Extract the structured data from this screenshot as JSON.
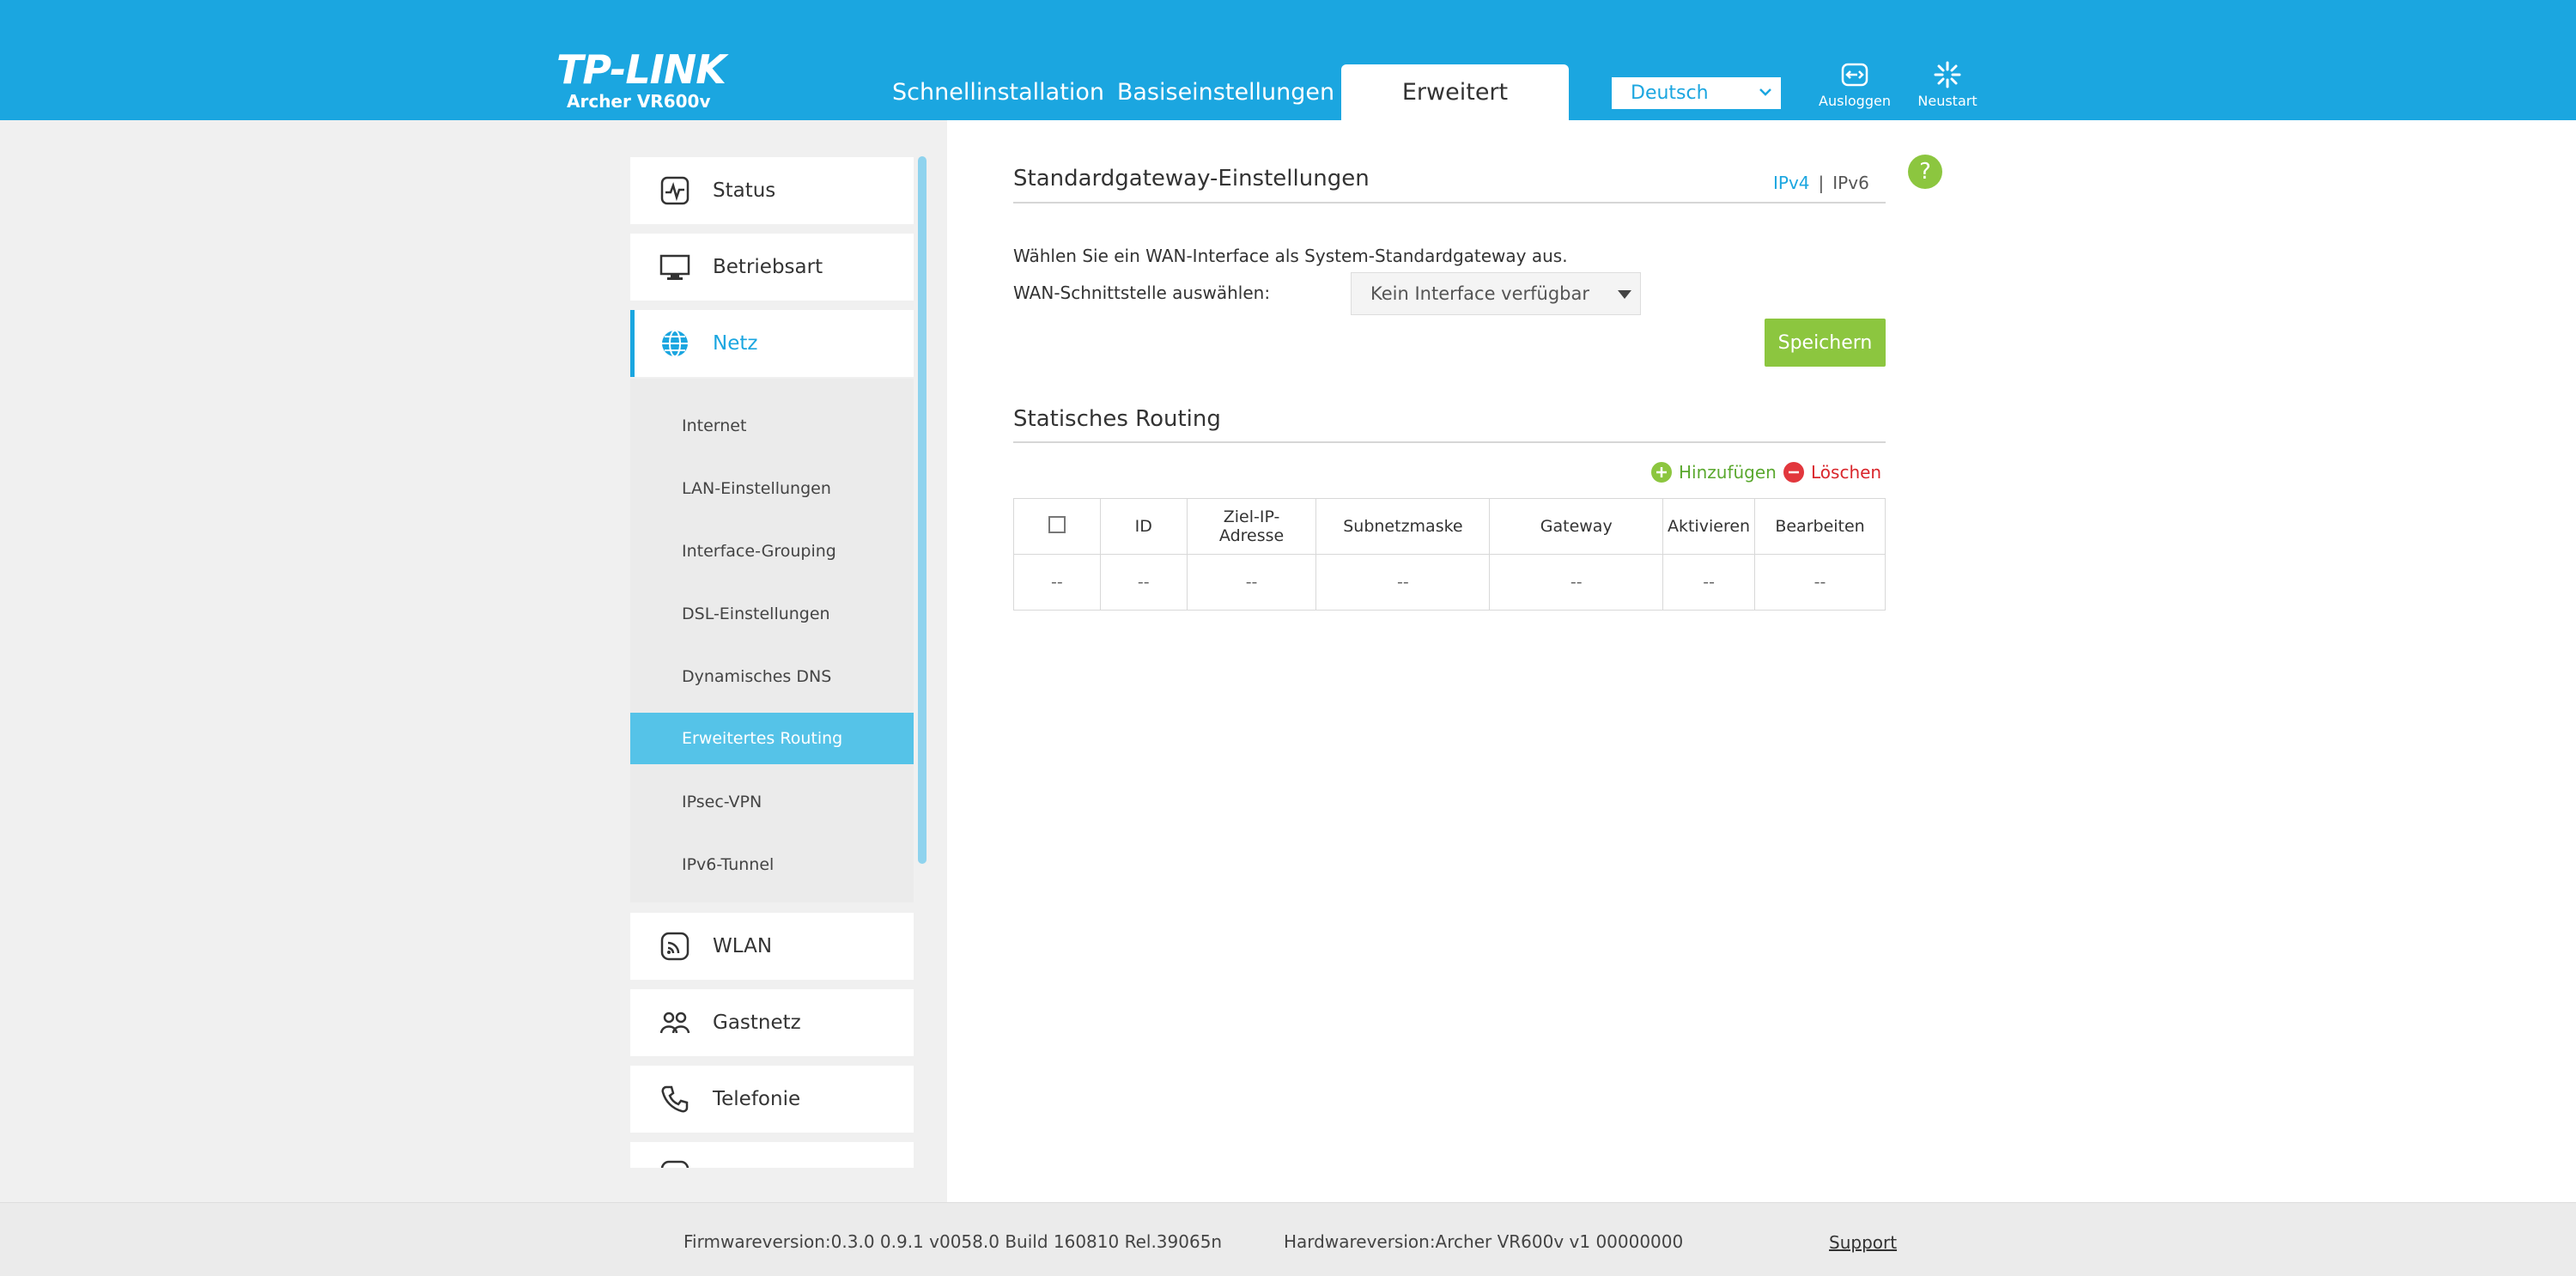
{
  "header": {
    "logo": "TP-LINK",
    "model": "Archer VR600v",
    "tabs": [
      {
        "label": "Schnellinstallation"
      },
      {
        "label": "Basiseinstellungen"
      },
      {
        "label": "Erweitert"
      }
    ],
    "language": "Deutsch",
    "logout_label": "Ausloggen",
    "restart_label": "Neustart",
    "brand_color": "#1ba6e0"
  },
  "sidebar": {
    "items": [
      {
        "label": "Status",
        "icon": "status-icon"
      },
      {
        "label": "Betriebsart",
        "icon": "monitor-icon"
      },
      {
        "label": "Netz",
        "icon": "globe-icon"
      },
      {
        "label": "WLAN",
        "icon": "wireless-icon"
      },
      {
        "label": "Gastnetz",
        "icon": "guests-icon"
      },
      {
        "label": "Telefonie",
        "icon": "phone-icon"
      }
    ],
    "sub_items": [
      {
        "label": "Internet"
      },
      {
        "label": "LAN-Einstellungen"
      },
      {
        "label": "Interface-Grouping"
      },
      {
        "label": "DSL-Einstellungen"
      },
      {
        "label": "Dynamisches DNS"
      },
      {
        "label": "Erweitertes Routing"
      },
      {
        "label": "IPsec-VPN"
      },
      {
        "label": "IPv6-Tunnel"
      }
    ]
  },
  "gateway": {
    "title": "Standardgateway-Einstellungen",
    "ipv4": "IPv4",
    "separator": "|",
    "ipv6": "IPv6",
    "description": "Wählen Sie ein WAN-Interface als System-Standardgateway aus.",
    "field_label": "WAN-Schnittstelle auswählen:",
    "field_value": "Kein Interface verfügbar",
    "save_label": "Speichern"
  },
  "routing": {
    "title": "Statisches Routing",
    "add_label": "Hinzufügen",
    "delete_label": "Löschen",
    "columns": [
      "ID",
      "Ziel-IP-\nAdresse",
      "Subnetzmaske",
      "Gateway",
      "Aktivieren",
      "Bearbeiten"
    ],
    "empty_row": [
      "--",
      "--",
      "--",
      "--",
      "--",
      "--",
      "--"
    ]
  },
  "help_label": "?",
  "footer": {
    "firmware": "Firmwareversion:0.3.0 0.9.1 v0058.0 Build 160810 Rel.39065n",
    "hardware": "Hardwareversion:Archer VR600v v1 00000000",
    "support": "Support"
  }
}
